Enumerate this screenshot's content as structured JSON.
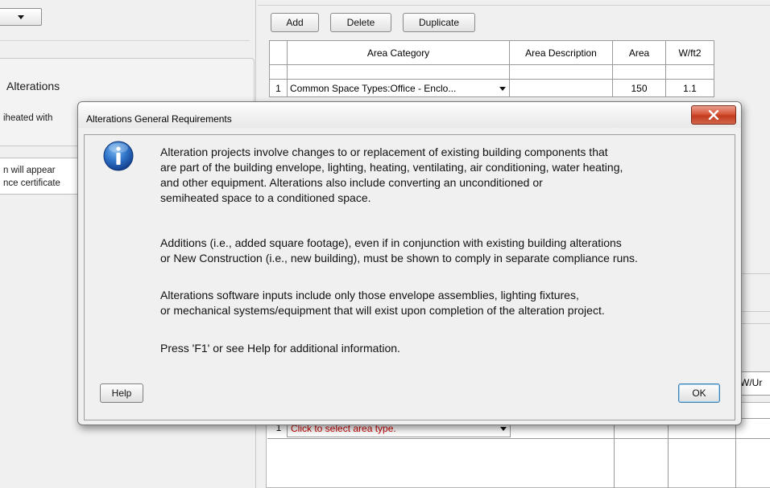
{
  "left": {
    "heading": "Alterations",
    "text_line1": "iheated with",
    "text_line2": "n will appear",
    "text_line3": "nce certificate"
  },
  "toolbar": {
    "add_label": "Add",
    "delete_label": "Delete",
    "duplicate_label": "Duplicate"
  },
  "grid": {
    "headers": [
      "Area Category",
      "Area Description",
      "Area",
      "W/ft2"
    ],
    "rows": [
      {
        "num": "1",
        "category": "Common Space Types:Office - Enclo...",
        "description": "",
        "area": "150",
        "wft2": "1.1"
      }
    ]
  },
  "bottom_grid": {
    "row_num": "1",
    "select_placeholder": "Click to select area type.",
    "unit_header": "W/Ur"
  },
  "dialog": {
    "title": "Alterations General Requirements",
    "paragraph1": "Alteration projects involve changes to or replacement of existing building components that\nare part of the building envelope, lighting, heating, ventilating, air conditioning, water heating,\nand other equipment. Alterations also include converting an unconditioned or\nsemiheated space to a conditioned space.",
    "paragraph2": "Additions (i.e., added square footage), even if in conjunction with existing building alterations\nor New Construction (i.e., new building), must be shown to comply in separate compliance runs.",
    "paragraph3": "Alterations software inputs include only those envelope assemblies, lighting fixtures,\nor mechanical systems/equipment that will exist upon completion of the alteration project.",
    "paragraph4": "Press 'F1' or see Help for additional information.",
    "help_label": "Help",
    "ok_label": "OK",
    "icon": "info-icon",
    "close_icon": "close-icon",
    "close_color": "#c7432a"
  }
}
